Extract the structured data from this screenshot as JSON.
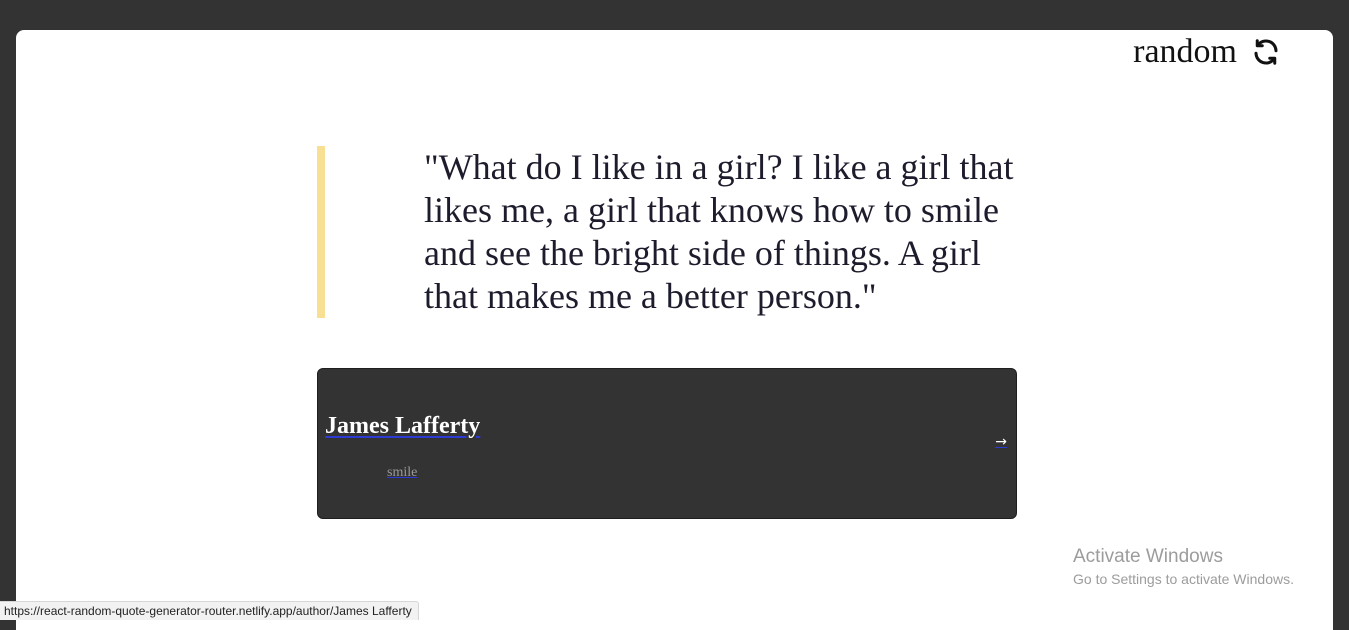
{
  "header": {
    "random_label": "random",
    "random_icon": "refresh-icon"
  },
  "quote": {
    "text": "\"What do I like in a girl? I like a girl that likes me, a girl that knows how to smile and see the bright side of things. A girl that makes me a better person.\"",
    "accent_color": "#f7df94"
  },
  "author_card": {
    "author": "James Lafferty",
    "genre": "smile",
    "arrow_icon": "arrow-right-icon",
    "background_color": "#333333"
  },
  "watermark": {
    "title": "Activate Windows",
    "subtitle": "Go to Settings to activate Windows."
  },
  "status_bar": {
    "url": "https://react-random-quote-generator-router.netlify.app/author/James Lafferty"
  }
}
